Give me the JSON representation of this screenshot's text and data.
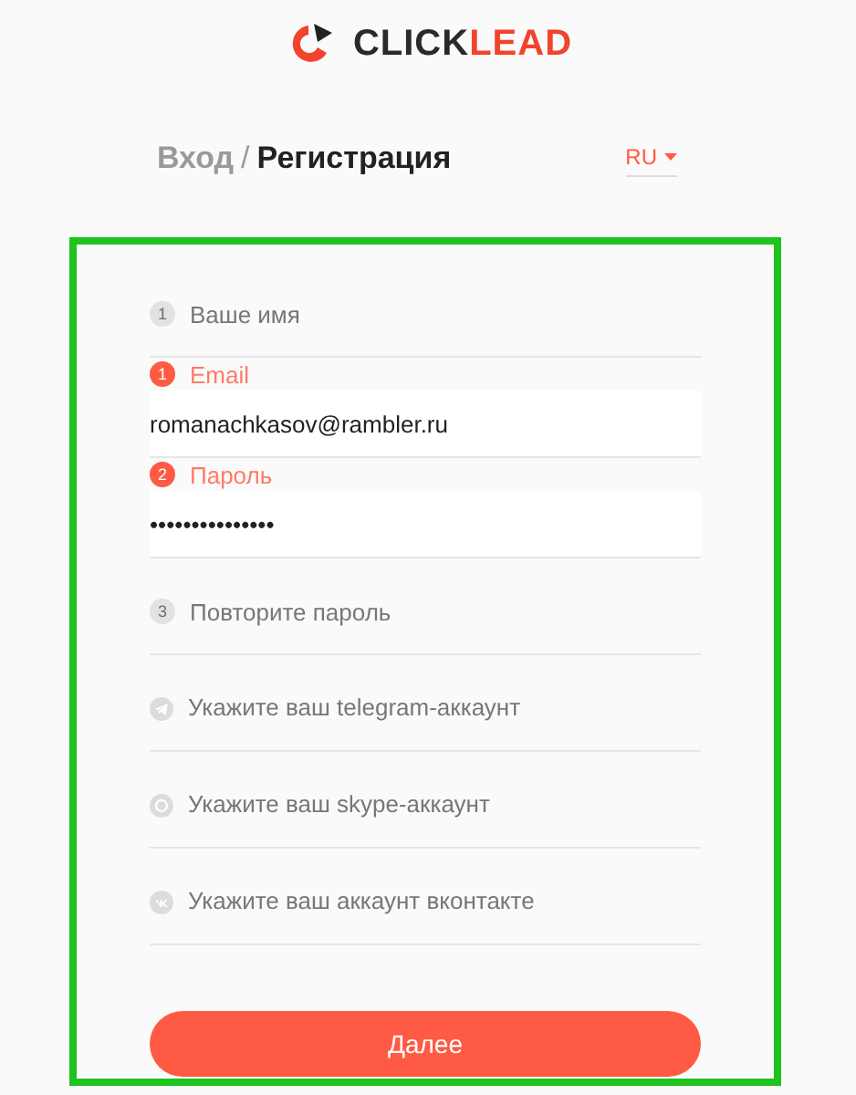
{
  "logo": {
    "text_dark": "CLICK",
    "text_accent": "LEAD"
  },
  "heading": {
    "login": "Вход",
    "separator": "/",
    "register": "Регистрация"
  },
  "language": {
    "value": "RU"
  },
  "fields": [
    {
      "kind": "number",
      "badge": "1",
      "placeholder": "Ваше имя"
    },
    {
      "kind": "number",
      "badge": "1",
      "label": "Email",
      "value": "romanachkasov@rambler.ru",
      "active": true
    },
    {
      "kind": "number",
      "badge": "2",
      "label": "Пароль",
      "value": "•••••••••••••••",
      "active": true
    },
    {
      "kind": "number",
      "badge": "3",
      "placeholder": "Повторите пароль"
    },
    {
      "kind": "telegram",
      "placeholder": "Укажите ваш telegram-аккаунт"
    },
    {
      "kind": "skype",
      "placeholder": "Укажите ваш skype-аккаунт"
    },
    {
      "kind": "vk",
      "placeholder": "Укажите ваш аккаунт вконтакте"
    }
  ],
  "submit": {
    "label": "Далее"
  }
}
